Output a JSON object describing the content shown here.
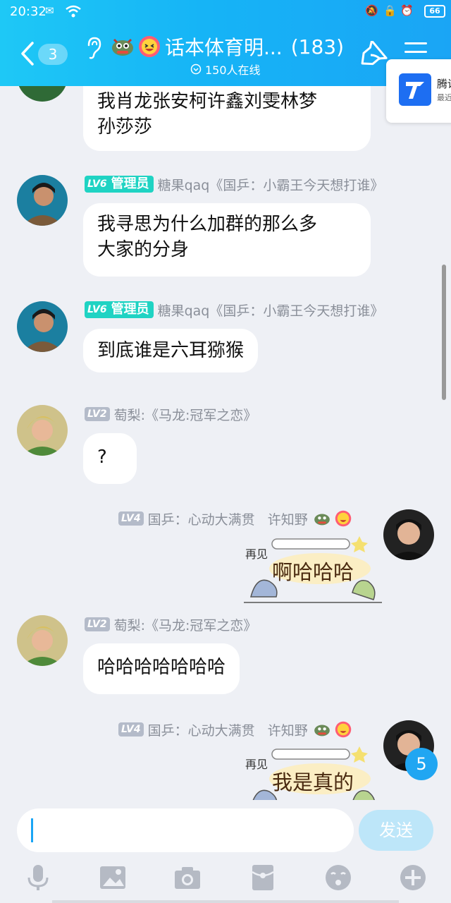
{
  "status_bar": {
    "time": "20:32",
    "battery": "66"
  },
  "header": {
    "unread_count": "3",
    "group_title": "话本体育明...",
    "member_count": "(183)",
    "online_text": "150人在线"
  },
  "tencent_card": {
    "name": "腾讯",
    "sub": "最近"
  },
  "messages": [
    {
      "text_line1": "我肖龙张安柯许鑫刘雯林梦",
      "text_line2": "孙莎莎"
    },
    {
      "level": "LV6",
      "badge": "管理员",
      "sender": "糖果qaq《国乒：小霸王今天想打谁》",
      "text_line1": "我寻思为什么加群的那么多",
      "text_line2": "大家的分身"
    },
    {
      "level": "LV6",
      "badge": "管理员",
      "sender": "糖果qaq《国乒：小霸王今天想打谁》",
      "text": "到底谁是六耳猕猴"
    },
    {
      "level": "LV2",
      "sender": "萄梨:《马龙:冠军之恋》",
      "text": "?"
    },
    {
      "level": "LV4",
      "sender": "国乒：心动大满贯   许知野",
      "sticker_top": "再见",
      "sticker_text": "啊哈哈哈"
    },
    {
      "level": "LV2",
      "sender": "萄梨:《马龙:冠军之恋》",
      "text": "哈哈哈哈哈哈哈"
    },
    {
      "level": "LV4",
      "sender": "国乒：心动大满贯   许知野",
      "sticker_top": "再见",
      "sticker_text": "我是真的"
    }
  ],
  "new_messages_badge": "5",
  "input": {
    "send_label": "发送"
  },
  "toolbar": [
    "microphone-icon",
    "image-icon",
    "camera-icon",
    "red-packet-icon",
    "emoji-icon",
    "plus-icon"
  ],
  "colors": {
    "header": "#1aa5f5",
    "background": "#eef0f5",
    "admin_badge": "#1fd3c3",
    "send": "#bde6f9"
  }
}
